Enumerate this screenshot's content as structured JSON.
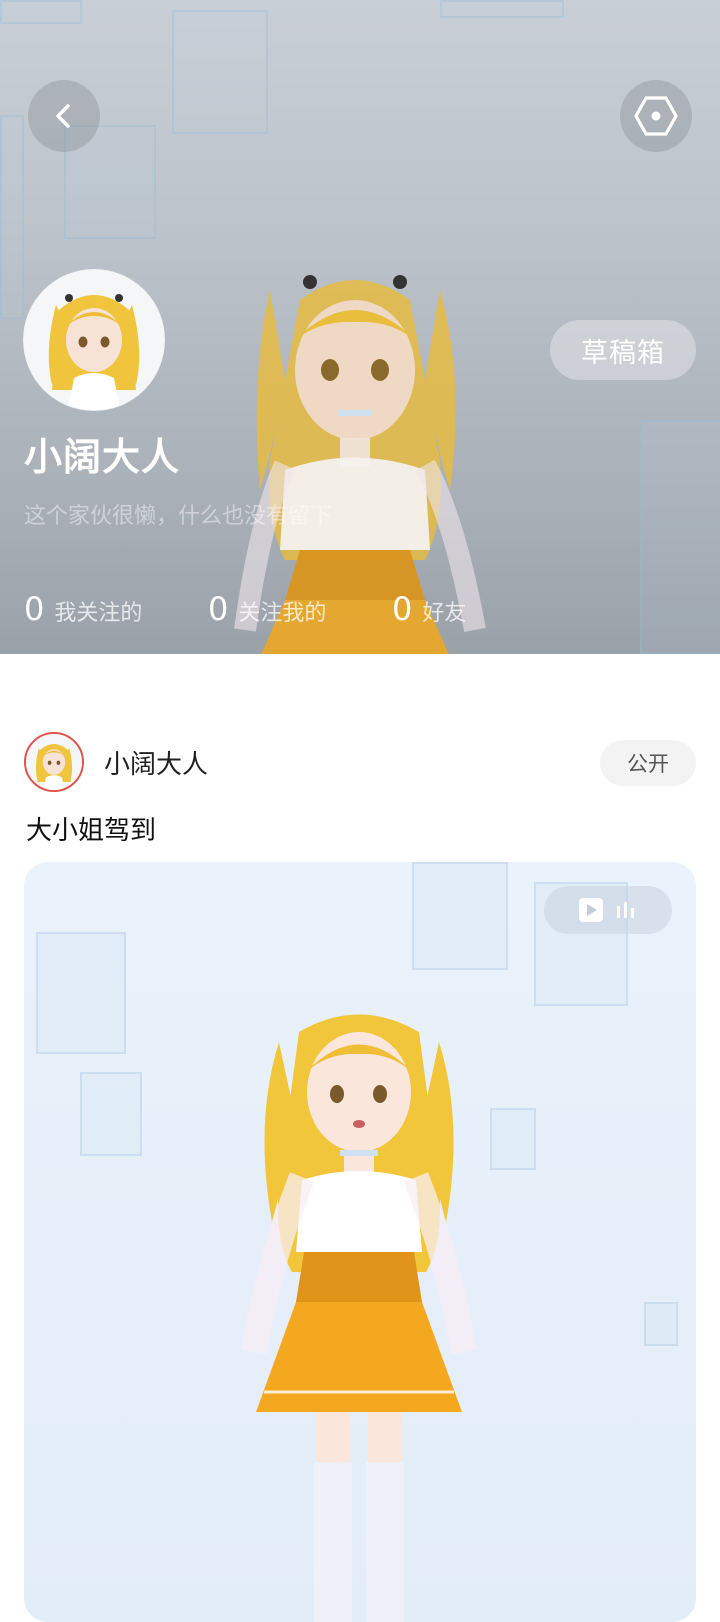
{
  "profile": {
    "username": "小阔大人",
    "bio": "这个家伙很懒，什么也没有留下",
    "drafts_label": "草稿箱",
    "stats": [
      {
        "count": "0",
        "label": "我关注的"
      },
      {
        "count": "0",
        "label": "关注我的"
      },
      {
        "count": "0",
        "label": "好友"
      }
    ]
  },
  "post": {
    "author": "小阔大人",
    "visibility": "公开",
    "text": "大小姐驾到",
    "media_type_icons": [
      "video-play-icon",
      "audio-bars-icon"
    ]
  },
  "icons": {
    "back": "chevron-left-icon",
    "settings": "hexagon-settings-icon"
  },
  "colors": {
    "avatar_ring": "#e0524a",
    "hair": "#f2c63a",
    "dress": "#f0a51a"
  }
}
